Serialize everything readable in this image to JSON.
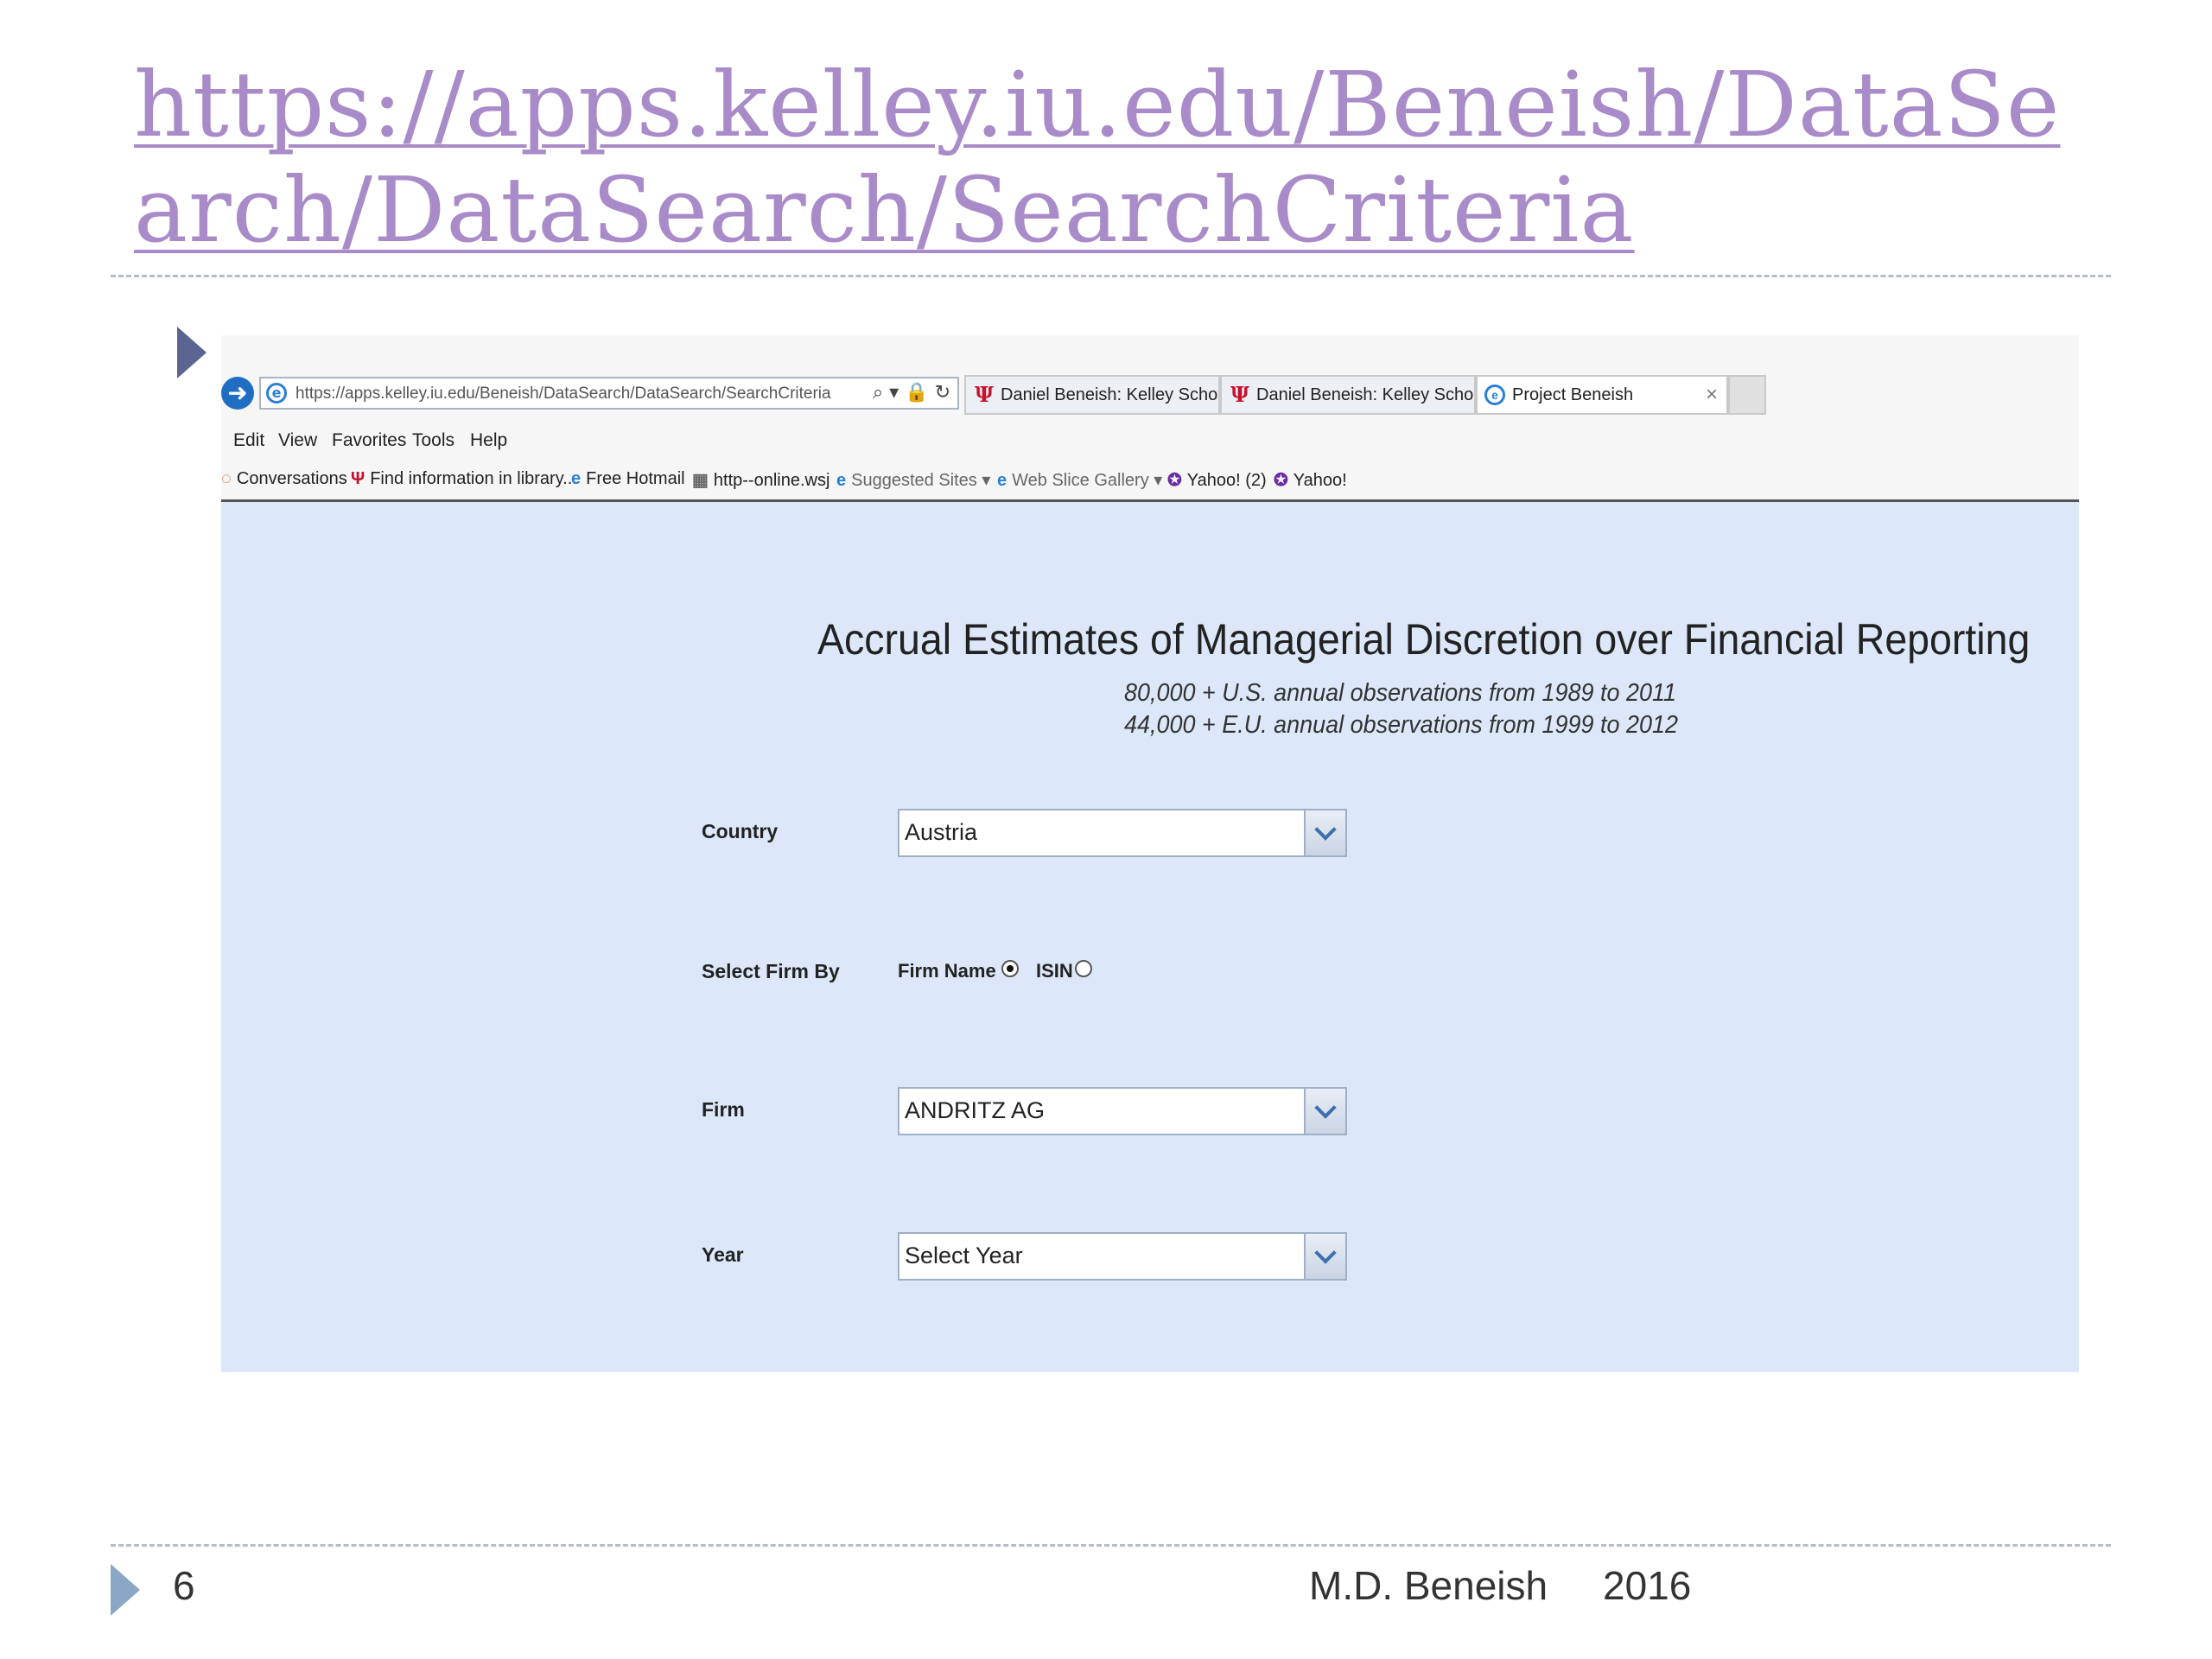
{
  "slide": {
    "title_line1": "https://apps.kelley.iu.edu/Beneish/DataSe",
    "title_line2": "arch/DataSearch/SearchCriteria",
    "page_number": "6",
    "footer": "M.D. Beneish     2016"
  },
  "browser": {
    "address": {
      "url": "https://apps.kelley.iu.edu/Beneish/DataSearch/DataSearch/SearchCriteria",
      "tools": "⌕ ▾ 🔒 ↻"
    },
    "tabs": [
      {
        "label": "Daniel Beneish: Kelley School o...",
        "icon": "iu-trident-icon"
      },
      {
        "label": "Daniel Beneish: Kelley School o...",
        "icon": "iu-trident-icon"
      },
      {
        "label": "Project Beneish",
        "icon": "ie-icon",
        "close": "×"
      }
    ],
    "menu": [
      "Edit",
      "View",
      "Favorites",
      "Tools",
      "Help"
    ],
    "favorites": [
      "Conversations",
      "Find information in library...",
      "Free Hotmail",
      "http--online.wsj",
      "Suggested Sites ▾",
      "Web Slice Gallery ▾",
      "Yahoo! (2)",
      "Yahoo!"
    ]
  },
  "page": {
    "title": "Accrual Estimates of Managerial Discretion over Financial Reporting",
    "subtitle_1": "80,000 + U.S. annual observations from 1989 to 2011",
    "subtitle_2": "44,000 + E.U. annual observations from 1999 to 2012",
    "form": {
      "country_label": "Country",
      "country_value": "Austria",
      "select_firm_by_label": "Select Firm By",
      "option_firm_name": "Firm Name",
      "option_isin": "ISIN",
      "selected_option": "Firm Name",
      "firm_label": "Firm",
      "firm_value": "ANDRITZ AG",
      "year_label": "Year",
      "year_value": "Select Year"
    }
  },
  "colors": {
    "title": "#a88bc8",
    "page_background": "#dce8f9",
    "bullet": "#5b6591"
  }
}
